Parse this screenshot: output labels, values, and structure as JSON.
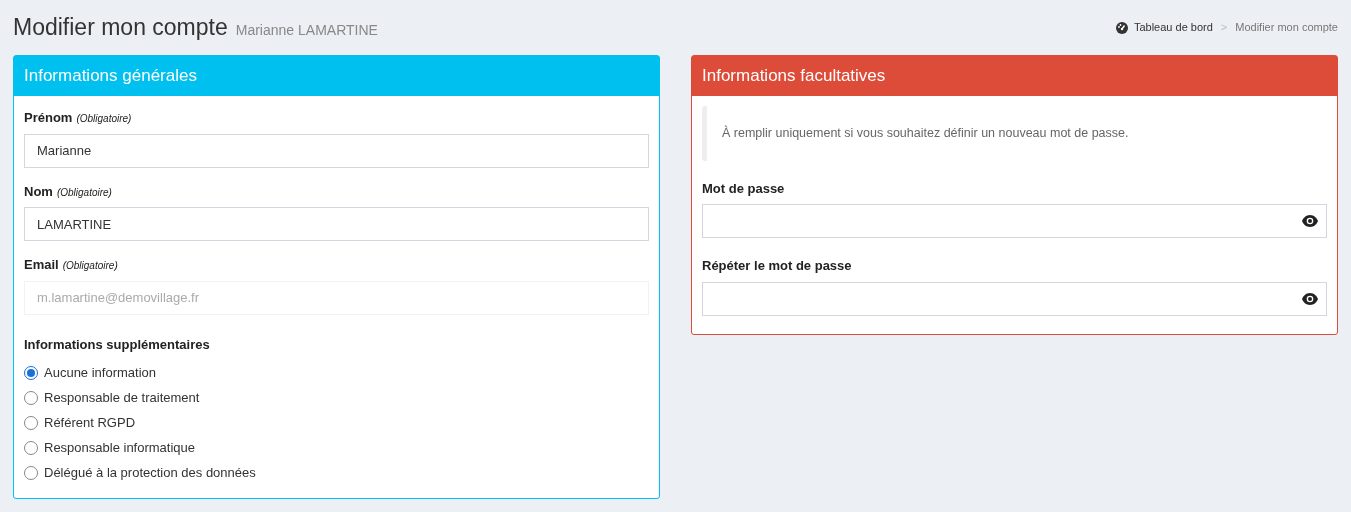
{
  "page": {
    "title": "Modifier mon compte",
    "subtitle": "Marianne LAMARTINE"
  },
  "breadcrumb": [
    {
      "label": "Tableau de bord",
      "kind": "home"
    },
    {
      "label": "Modifier mon compte",
      "kind": "current"
    }
  ],
  "breadcrumb_separator": ">",
  "general": {
    "title": "Informations générales",
    "fields": [
      {
        "label": "Prénom",
        "hint": "(Obligatoire)",
        "value": "Marianne"
      },
      {
        "label": "Nom",
        "hint": "(Obligatoire)",
        "value": "LAMARTINE"
      },
      {
        "label": "Email",
        "hint": "(Obligatoire)",
        "value": "m.lamartine@demovillage.fr"
      }
    ],
    "extra_label": "Informations supplémentaires",
    "options": [
      {
        "label": "Aucune information",
        "selected": true
      },
      {
        "label": "Responsable de traitement",
        "selected": false
      },
      {
        "label": "Référent RGPD",
        "selected": false
      },
      {
        "label": "Responsable informatique",
        "selected": false
      },
      {
        "label": "Délégué à la protection des données",
        "selected": false
      }
    ]
  },
  "optional": {
    "title": "Informations facultatives",
    "note": "À remplir uniquement si vous souhaitez définir un nouveau mot de passe.",
    "fields": [
      {
        "label": "Mot de passe"
      },
      {
        "label": "Répéter le mot de passe"
      }
    ]
  }
}
